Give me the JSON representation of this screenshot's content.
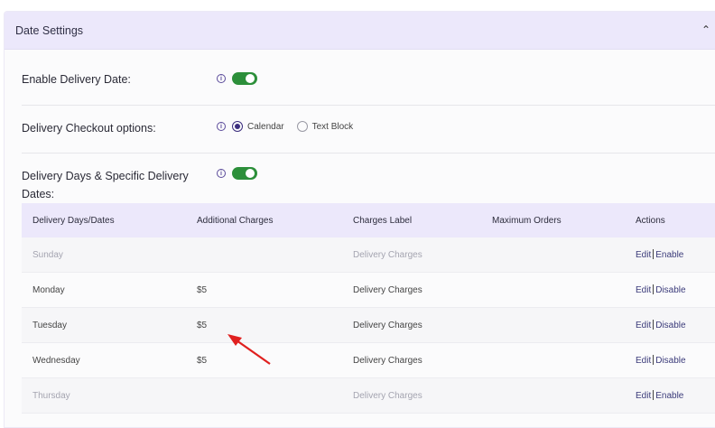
{
  "section": {
    "title": "Date Settings"
  },
  "settings": {
    "enable_delivery_date": {
      "label": "Enable Delivery Date:",
      "enabled": true
    },
    "checkout_options": {
      "label": "Delivery Checkout options:",
      "options": [
        "Calendar",
        "Text Block"
      ],
      "selected": "Calendar"
    },
    "delivery_days": {
      "label_line1": "Delivery Days & Specific Delivery",
      "label_line2": "Dates:",
      "enabled": true
    }
  },
  "table": {
    "headers": [
      "Delivery Days/Dates",
      "Additional Charges",
      "Charges Label",
      "Maximum Orders",
      "Actions"
    ],
    "rows": [
      {
        "day": "Sunday",
        "charge": "",
        "label": "Delivery Charges",
        "max": "",
        "edit": "Edit",
        "toggle": "Enable",
        "disabled": true
      },
      {
        "day": "Monday",
        "charge": "$5",
        "label": "Delivery Charges",
        "max": "",
        "edit": "Edit",
        "toggle": "Disable",
        "disabled": false
      },
      {
        "day": "Tuesday",
        "charge": "$5",
        "label": "Delivery Charges",
        "max": "",
        "edit": "Edit",
        "toggle": "Disable",
        "disabled": false
      },
      {
        "day": "Wednesday",
        "charge": "$5",
        "label": "Delivery Charges",
        "max": "",
        "edit": "Edit",
        "toggle": "Disable",
        "disabled": false
      },
      {
        "day": "Thursday",
        "charge": "",
        "label": "Delivery Charges",
        "max": "",
        "edit": "Edit",
        "toggle": "Enable",
        "disabled": true
      }
    ]
  },
  "colors": {
    "accent": "#3b2e7e",
    "toggle_on": "#2c8f3a",
    "header_bg": "#ece8fb",
    "annotation_arrow": "#e0201f"
  },
  "icons": {
    "collapse": "chevron-up-icon",
    "info": "info-icon"
  }
}
